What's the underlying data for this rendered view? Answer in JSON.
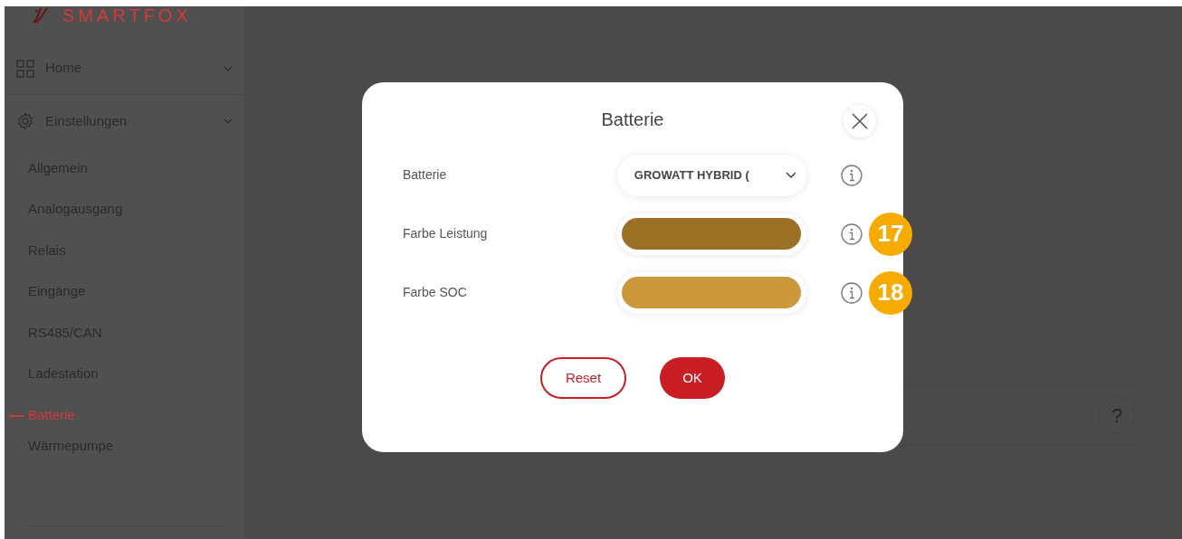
{
  "logo": {
    "text": "SMARTFOX"
  },
  "sidebar": {
    "groups": [
      {
        "label": "Home",
        "kind": "grid"
      },
      {
        "label": "Einstellungen",
        "kind": "gear"
      }
    ],
    "items": [
      {
        "label": "Allgemein",
        "selected": false
      },
      {
        "label": "Analogausgang",
        "selected": false
      },
      {
        "label": "Relais",
        "selected": false
      },
      {
        "label": "Eingänge",
        "selected": false
      },
      {
        "label": "RS485/CAN",
        "selected": false
      },
      {
        "label": "Ladestation",
        "selected": false
      },
      {
        "label": "Batterie",
        "selected": true
      },
      {
        "label": "Wärmepumpe",
        "selected": false
      }
    ]
  },
  "help": {
    "text": "?"
  },
  "dialog": {
    "title": "Batterie",
    "fields": [
      {
        "kind": "select",
        "label": "Batterie",
        "value": "GROWATT HYBRID ("
      },
      {
        "kind": "color",
        "label": "Farbe Leistung",
        "color": "#9a7024",
        "badge": "17"
      },
      {
        "kind": "color",
        "label": "Farbe SOC",
        "color": "#cb993c",
        "badge": "18"
      }
    ],
    "buttons": [
      {
        "kind": "outline",
        "label": "Reset"
      },
      {
        "kind": "primary",
        "label": "OK"
      }
    ]
  }
}
